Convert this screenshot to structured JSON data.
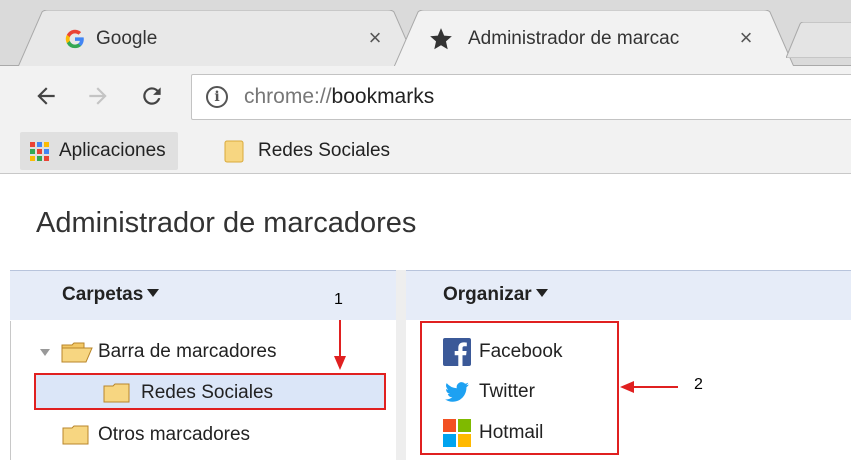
{
  "tabs": [
    {
      "title": "Google",
      "favicon": "google-g-icon",
      "close": "×"
    },
    {
      "title": "Administrador de marcac",
      "favicon": "star-icon",
      "close": "×",
      "active": true
    }
  ],
  "toolbar": {
    "url_scheme": "chrome://",
    "url_host": "bookmarks"
  },
  "bookmarks_bar": {
    "apps_label": "Aplicaciones",
    "folder_label": "Redes Sociales"
  },
  "page": {
    "title": "Administrador de marcadores"
  },
  "menus": {
    "folders_label": "Carpetas",
    "organize_label": "Organizar"
  },
  "tree": [
    {
      "label": "Barra de marcadores",
      "expanded": true,
      "icon": "open-folder-icon"
    },
    {
      "label": "Redes Sociales",
      "selected": true,
      "icon": "folder-icon"
    },
    {
      "label": "Otros marcadores",
      "icon": "folder-icon"
    }
  ],
  "bookmarks": [
    {
      "label": "Facebook",
      "icon": "facebook-icon"
    },
    {
      "label": "Twitter",
      "icon": "twitter-icon"
    },
    {
      "label": "Hotmail",
      "icon": "microsoft-icon"
    }
  ],
  "annotations": {
    "one": "1",
    "two": "2"
  },
  "colors": {
    "highlight": "#e02020",
    "selection": "#dbe6f8",
    "header_bar": "#e6ecf8",
    "facebook": "#3b5998",
    "twitter": "#1da1f2",
    "folder": "#f7d681"
  }
}
